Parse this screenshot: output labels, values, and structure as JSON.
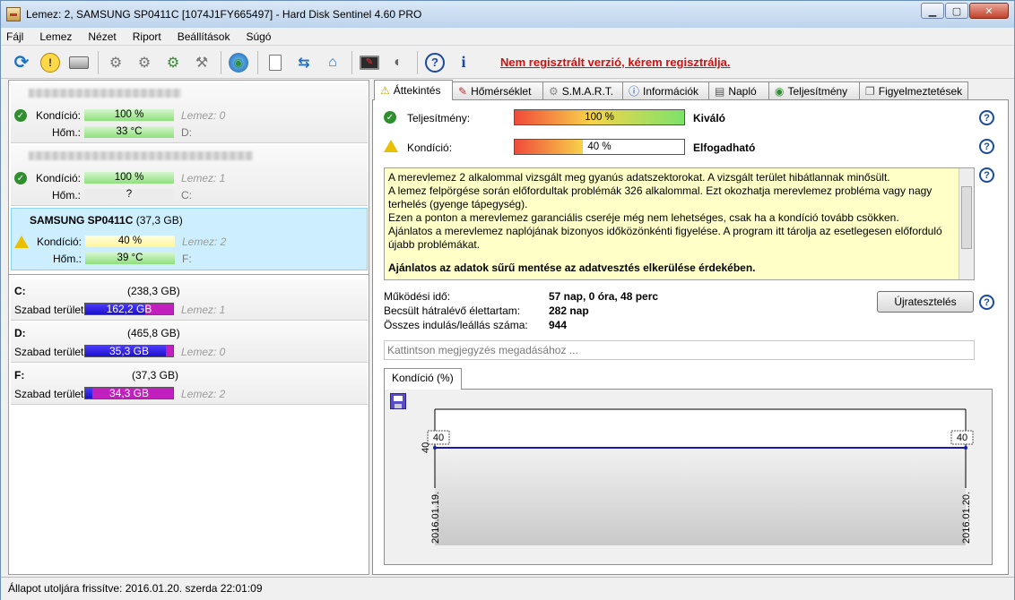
{
  "window": {
    "title": "Lemez: 2, SAMSUNG SP0411C [1074J1FY665497]  -  Hard Disk Sentinel 4.60 PRO"
  },
  "menu": [
    "Fájl",
    "Lemez",
    "Nézet",
    "Riport",
    "Beállítások",
    "Súgó"
  ],
  "toolbar": {
    "register_link": "Nem regisztrált verzió, kérem regisztrálja."
  },
  "disks": [
    {
      "name": "",
      "condition_label": "Kondíció:",
      "condition": "100 %",
      "health_level": 100,
      "status": "ok",
      "temp_label": "Hőm.:",
      "temp": "33 °C",
      "disk_index": "Lemez: 0",
      "drive": "D:"
    },
    {
      "name": "",
      "condition_label": "Kondíció:",
      "condition": "100 %",
      "health_level": 100,
      "status": "ok",
      "temp_label": "Hőm.:",
      "temp": "?",
      "disk_index": "Lemez: 1",
      "drive": "C:"
    },
    {
      "name": "SAMSUNG SP0411C",
      "size": "(37,3 GB)",
      "condition_label": "Kondíció:",
      "condition": "40 %",
      "health_level": 40,
      "status": "warn",
      "temp_label": "Hőm.:",
      "temp": "39 °C",
      "disk_index": "Lemez: 2",
      "drive": "F:"
    }
  ],
  "partitions": [
    {
      "letter": "C:",
      "size": "(238,3 GB)",
      "free_label": "Szabad terület",
      "free": "162,2 GB",
      "used_fraction": 0.68,
      "disk": "Lemez: 1"
    },
    {
      "letter": "D:",
      "size": "(465,8 GB)",
      "free_label": "Szabad terület",
      "free": "35,3 GB",
      "used_fraction": 0.92,
      "disk": "Lemez: 0"
    },
    {
      "letter": "F:",
      "size": "(37,3 GB)",
      "free_label": "Szabad terület",
      "free": "34,3 GB",
      "used_fraction": 0.08,
      "disk": "Lemez: 2"
    }
  ],
  "tabs": [
    "Áttekintés",
    "Hőmérséklet",
    "S.M.A.R.T.",
    "Információk",
    "Napló",
    "Teljesítmény",
    "Figyelmeztetések"
  ],
  "overview": {
    "performance_label": "Teljesítmény:",
    "performance_value": "100 %",
    "performance_level": 100,
    "performance_text": "Kiváló",
    "condition_label": "Kondíció:",
    "condition_value": "40 %",
    "condition_level": 40,
    "condition_text": "Elfogadható",
    "message_lines": [
      "A merevlemez 2 alkalommal vizsgált meg gyanús adatszektorokat. A vizsgált terület hibátlannak minősült.",
      "A lemez felpörgése során előfordultak problémák 326 alkalommal. Ezt okozhatja merevlemez probléma vagy nagy terhelés (gyenge tápegység).",
      "Ezen a ponton a merevlemez garanciális cseréje még nem lehetséges, csak ha a kondíció tovább csökken.",
      "Ajánlatos a merevlemez naplójának bizonyos időközönkénti figyelése. A program itt tárolja az esetlegesen előforduló újabb problémákat."
    ],
    "message_bold": "Ajánlatos az adatok sűrű mentése az adatvesztés elkerülése érdekében.",
    "uptime_label": "Működési idő:",
    "uptime": "57 nap, 0 óra, 48 perc",
    "remaining_label": "Becsült hátralévő élettartam:",
    "remaining": "282 nap",
    "starts_label": "Összes indulás/leállás száma:",
    "starts": "944",
    "retest_button": "Újratesztelés",
    "note_placeholder": "Kattintson megjegyzés megadásához ...",
    "chart_tab": "Kondíció  (%)"
  },
  "chart_data": {
    "type": "line",
    "x": [
      "2016.01.19.",
      "2016.01.20."
    ],
    "series": [
      {
        "values": [
          40,
          40
        ]
      }
    ],
    "point_labels": [
      "40",
      "40"
    ],
    "ytick": "40",
    "ylim": [
      0,
      100
    ],
    "color": "#1a1aa8"
  },
  "statusbar": {
    "text": "Állapot utoljára frissítve: 2016.01.20. szerda 22:01:09"
  },
  "colors": {
    "ok": "#2f8f2f",
    "warn": "#e8c000",
    "register": "#d31010"
  }
}
